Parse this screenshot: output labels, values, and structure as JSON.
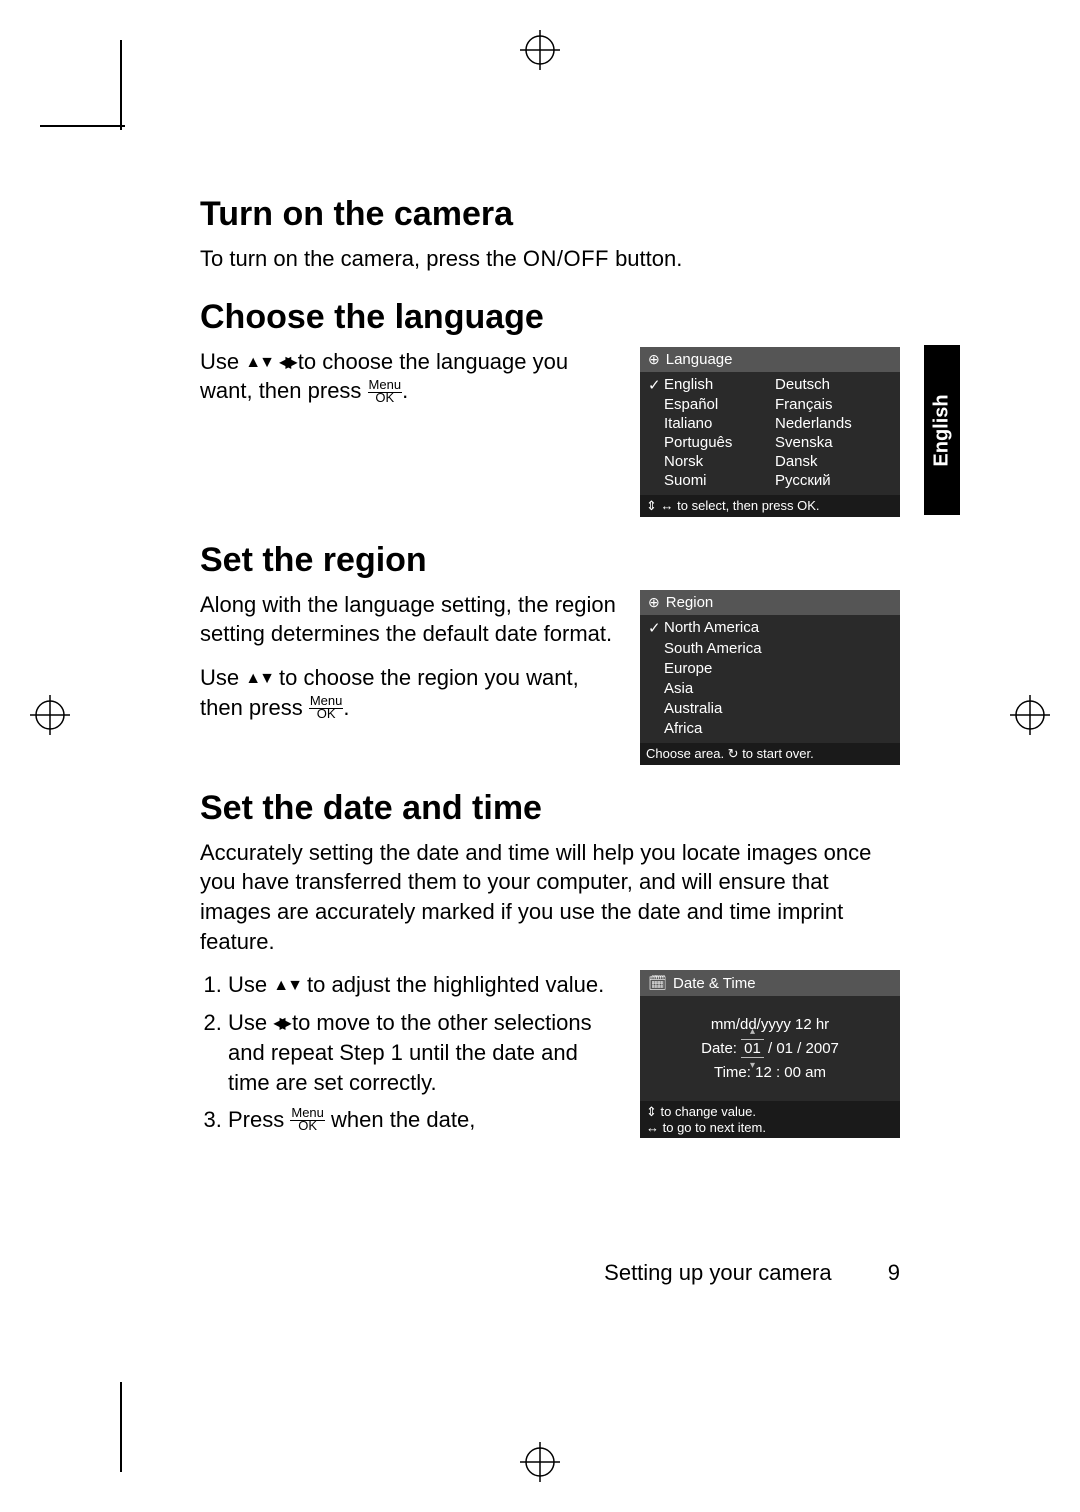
{
  "side_tab": "English",
  "sections": {
    "turn_on": {
      "heading": "Turn on the camera",
      "body_pre": "To turn on the camera, press the ",
      "onoff": "ON/OFF",
      "body_post": " button."
    },
    "language": {
      "heading": "Choose the language",
      "body_pre": "Use ",
      "body_mid": " to choose the language you want, then press ",
      "body_post": ".",
      "lcd": {
        "title": "Language",
        "items_left": [
          "English",
          "Español",
          "Italiano",
          "Português",
          "Norsk",
          "Suomi"
        ],
        "items_right": [
          "Deutsch",
          "Français",
          "Nederlands",
          "Svenska",
          "Dansk",
          "Русский"
        ],
        "selected_index": 0,
        "footer": "to select, then press OK."
      }
    },
    "region": {
      "heading": "Set the region",
      "para1": "Along with the language setting, the region setting determines the default date format.",
      "para2_pre": "Use ",
      "para2_mid": " to choose the region you want, then press ",
      "para2_post": ".",
      "lcd": {
        "title": "Region",
        "items": [
          "North America",
          "South America",
          "Europe",
          "Asia",
          "Australia",
          "Africa"
        ],
        "selected_index": 0,
        "footer": "Choose area. ",
        "footer2": " to start over."
      }
    },
    "datetime": {
      "heading": "Set the date and time",
      "intro": "Accurately setting the date and time will help you locate images once you have transferred them to your computer, and will ensure that images are accurately marked if you use the date and time imprint feature.",
      "steps": [
        {
          "pre": "Use ",
          "mid": " to adjust the highlighted value."
        },
        {
          "pre": "Use ",
          "mid": " to move to the other selections and repeat Step 1 until the date and time are set correctly."
        },
        {
          "pre": "Press ",
          "mid": " when the date,"
        }
      ],
      "lcd": {
        "title": "Date & Time",
        "format": "mm/dd/yyyy  12 hr",
        "date_label": "Date:",
        "date_hl": "01",
        "date_rest": " / 01 / 2007",
        "time_label": "Time:",
        "time_val": "12 : 00  am",
        "footer1": "to change value.",
        "footer2": "to go to next item."
      }
    }
  },
  "footer": {
    "text": "Setting up your camera",
    "page": "9"
  },
  "menu_ok": {
    "top": "Menu",
    "bottom": "OK"
  }
}
